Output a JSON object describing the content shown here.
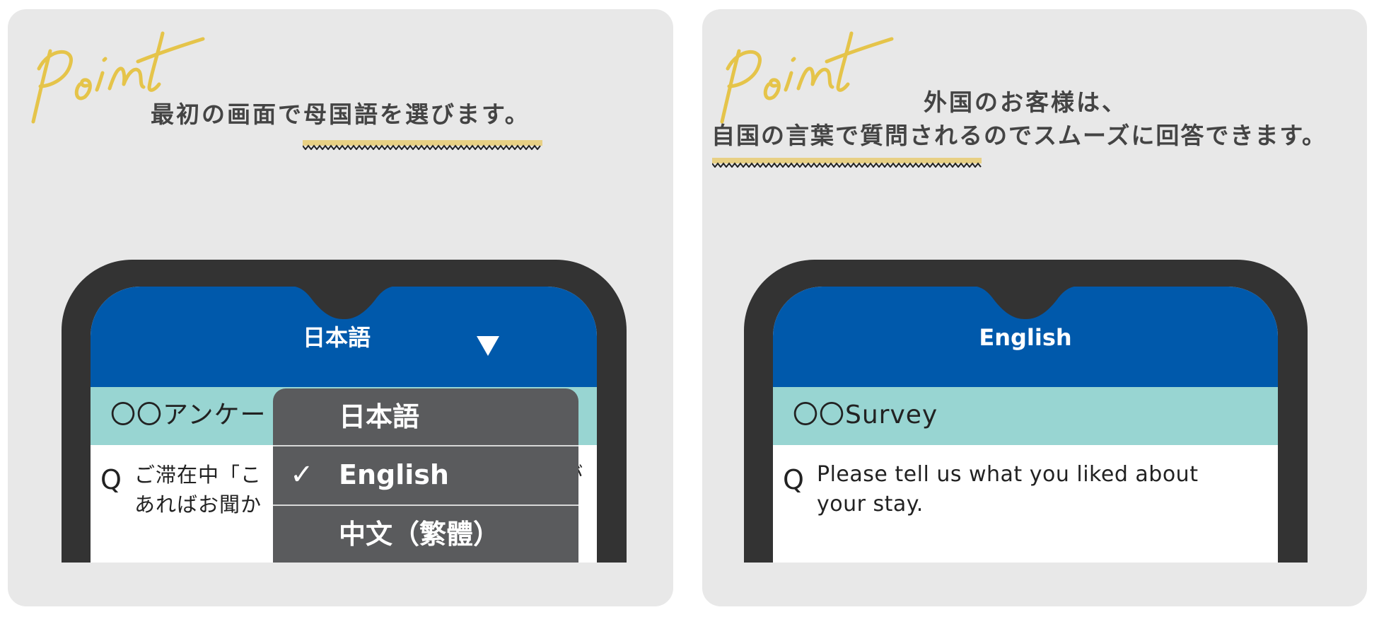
{
  "colors": {
    "panel_bg": "#e8e8e8",
    "accent_yellow": "#e5c44a",
    "underline_yellow": "#e8d084",
    "heading_text": "#444444",
    "phone_bezel": "#333333",
    "header_blue": "#0059ab",
    "survey_teal": "#98d5d2",
    "dropdown_bg": "#5a5b5d"
  },
  "left_panel": {
    "badge": "Point",
    "headline": "最初の画面で母国語を選びます。",
    "headline_highlight": "母国語を選びます。",
    "phone": {
      "header_title": "日本語",
      "dropdown_icon": "triangle-down-icon",
      "survey_title": "〇〇アンケー",
      "question_mark": "Q",
      "question_lines": [
        "ご滞在中「こ",
        "あればお聞か"
      ],
      "question_line1_tail": "が",
      "dropdown": {
        "items": [
          {
            "label": "日本語",
            "selected": false
          },
          {
            "label": "English",
            "selected": true
          },
          {
            "label": "中文（繁體）",
            "selected": false
          }
        ],
        "check_icon": "✓"
      }
    }
  },
  "right_panel": {
    "badge": "Point",
    "headline_line1": "外国のお客様は、",
    "headline_line2": "自国の言葉で質問されるのでスムーズに回答できます。",
    "headline_highlight": "自国の言葉で質問",
    "phone": {
      "header_title": "English",
      "survey_title": "〇〇Survey",
      "question_mark": "Q",
      "question_lines": [
        "Please tell us what you liked about",
        "your stay."
      ]
    }
  }
}
